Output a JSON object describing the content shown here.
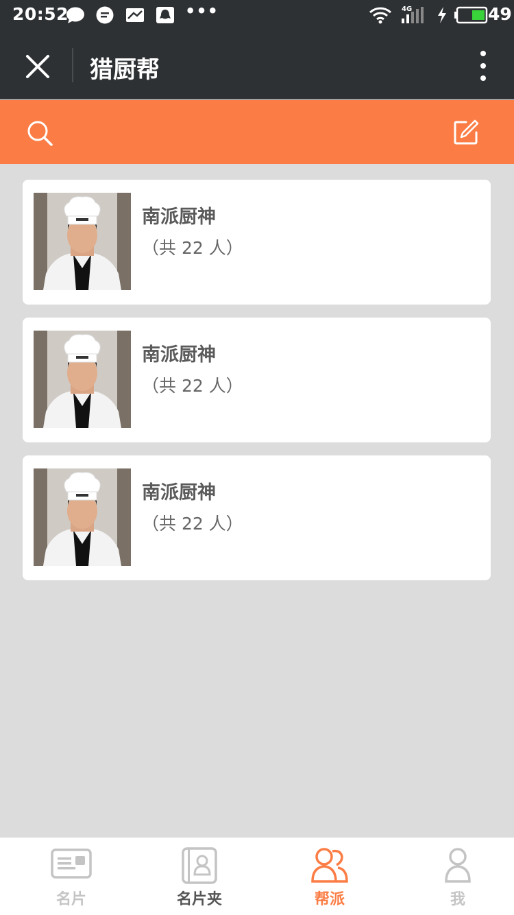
{
  "status_bar": {
    "time": "20:52",
    "battery": "49",
    "network": "4G"
  },
  "title_bar": {
    "title": "猎厨帮"
  },
  "colors": {
    "accent": "#fb7d45",
    "dark": "#2e3134",
    "inactive_tab": "#c4c4c4",
    "active_tab": "#fb7d45"
  },
  "groups": [
    {
      "name": "南派厨神",
      "count_text": "（共 22 人）"
    },
    {
      "name": "南派厨神",
      "count_text": "（共 22 人）"
    },
    {
      "name": "南派厨神",
      "count_text": "（共 22 人）"
    }
  ],
  "tabs": [
    {
      "label": "名片",
      "icon": "business-card-icon",
      "active": false
    },
    {
      "label": "名片夹",
      "icon": "card-holder-icon",
      "active": false
    },
    {
      "label": "帮派",
      "icon": "group-icon",
      "active": true
    },
    {
      "label": "我",
      "icon": "person-icon",
      "active": false
    }
  ]
}
